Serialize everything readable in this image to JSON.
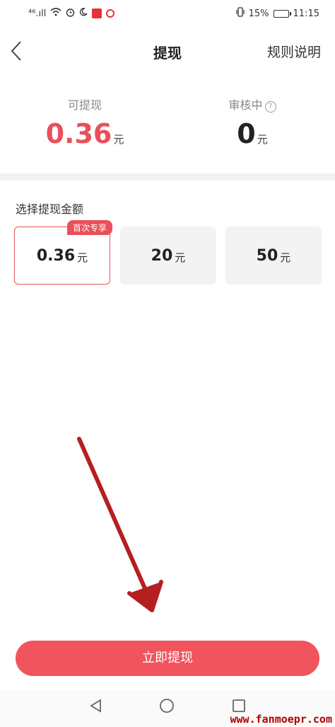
{
  "status_bar": {
    "signal": "⁴⁶.ıll",
    "battery_pct": "15%",
    "time": "11:15"
  },
  "nav": {
    "title": "提现",
    "rules": "规则说明"
  },
  "balance": {
    "available_label": "可提现",
    "available_value": "0.36",
    "available_unit": "元",
    "reviewing_label": "审核中",
    "reviewing_value": "0",
    "reviewing_unit": "元"
  },
  "select": {
    "label": "选择提现金额",
    "options": [
      {
        "value": "0.36",
        "unit": "元",
        "badge": "首次专享",
        "selected": true
      },
      {
        "value": "20",
        "unit": "元",
        "selected": false
      },
      {
        "value": "50",
        "unit": "元",
        "selected": false
      }
    ]
  },
  "withdraw_button": "立即提现",
  "watermark": "www.fanmoepr.com",
  "colors": {
    "accent": "#e9505a",
    "button": "#f1545c",
    "arrow": "#b51f20"
  }
}
